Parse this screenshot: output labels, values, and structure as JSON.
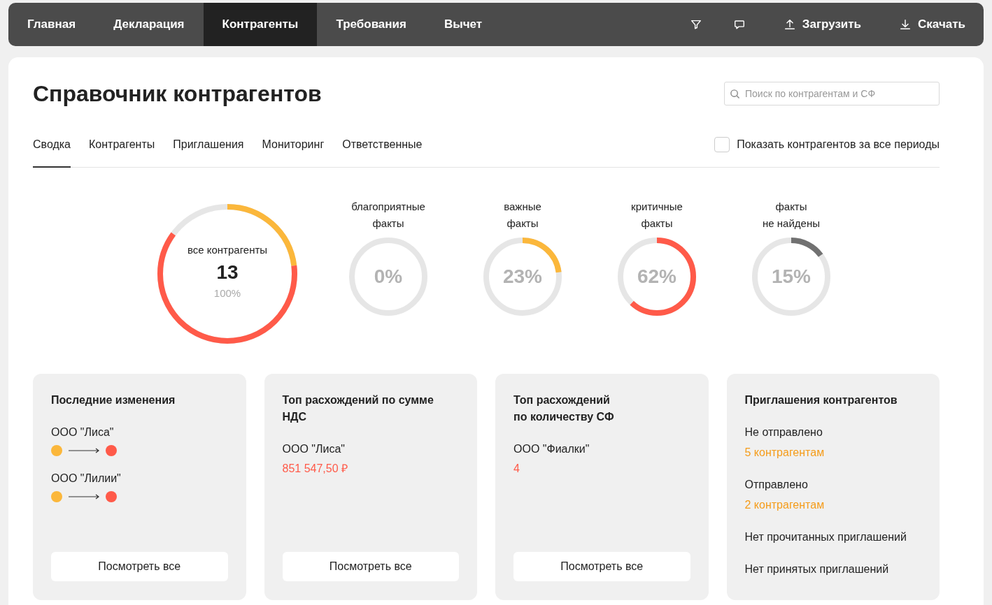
{
  "nav": {
    "tabs": [
      {
        "label": "Главная",
        "selected": false
      },
      {
        "label": "Декларация",
        "selected": false
      },
      {
        "label": "Контрагенты",
        "selected": true
      },
      {
        "label": "Требования",
        "selected": false
      },
      {
        "label": "Вычет",
        "selected": false
      }
    ],
    "actions": [
      {
        "kind": "filter"
      },
      {
        "kind": "comment"
      },
      {
        "kind": "upload",
        "label": "Загрузить"
      },
      {
        "kind": "download",
        "label": "Скачать"
      }
    ]
  },
  "title": "Справочник контрагентов",
  "search": {
    "placeholder": "Поиск по контрагентам и СФ"
  },
  "tabs": [
    {
      "label": "Сводка",
      "selected": true
    },
    {
      "label": "Контрагенты",
      "selected": false
    },
    {
      "label": "Приглашения",
      "selected": false
    },
    {
      "label": "Мониторинг",
      "selected": false
    },
    {
      "label": "Ответственные",
      "selected": false
    }
  ],
  "show_all_periods": {
    "label": "Показать контрагентов за все периоды",
    "checked": false
  },
  "summary": {
    "label": "все контрагенты",
    "count": "13",
    "percent": "100%",
    "segments": [
      {
        "color": "#fbb73b",
        "level": 0.23
      },
      {
        "color": "#ff5a49",
        "level": 0.62
      }
    ]
  },
  "facts": [
    {
      "label": "благоприятные\nфакты",
      "value": "0%",
      "level": 0
    },
    {
      "label": "важные\nфакты",
      "value": "23%",
      "level": 0.23,
      "color": "#fbb73b"
    },
    {
      "label": "критичные\nфакты",
      "value": "62%",
      "level": 0.62,
      "color": "#ff5a49"
    },
    {
      "label": "факты\nне найдены",
      "value": "15%",
      "level": 0.15,
      "color": "#717171"
    }
  ],
  "cards": [
    {
      "kind": "changes",
      "title": "Последние изменения",
      "items": [
        {
          "name": "ООО \"Лиса\"",
          "from": {
            "color": "#fbb73b"
          },
          "to": {
            "color": "#ff5a49"
          }
        },
        {
          "name": "ООО \"Лилии\"",
          "from": {
            "color": "#fbb73b"
          },
          "to": {
            "color": "#ff5a49"
          }
        }
      ],
      "button": "Посмотреть все"
    },
    {
      "kind": "top",
      "title": "Топ расхождений по сумме НДС",
      "company": "ООО \"Лиса\"",
      "value": "851 547,50 ₽",
      "button": "Посмотреть все"
    },
    {
      "kind": "top",
      "title": "Топ расхождений\nпо количеству СФ",
      "company": "ООО \"Фиалки\"",
      "value": "4",
      "button": "Посмотреть все"
    },
    {
      "kind": "invites",
      "title": "Приглашения контрагентов",
      "items": [
        {
          "label": "Не отправлено",
          "link": "5 контрагентам"
        },
        {
          "label": "Отправлено",
          "link": "2 контрагентам"
        },
        {
          "label": "Нет прочитанных приглашений"
        },
        {
          "label": "Нет принятых приглашений"
        }
      ]
    }
  ]
}
